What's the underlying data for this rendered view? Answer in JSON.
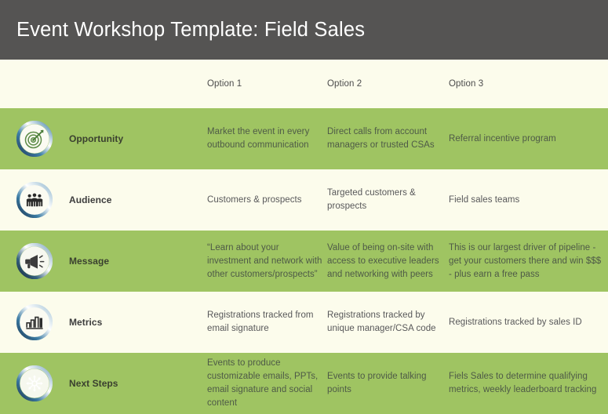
{
  "title": "Event Workshop Template: Field Sales",
  "colors": {
    "title_bar": "#555453",
    "band_green": "#9FC462",
    "band_cream": "#FCFCEC",
    "title_text": "#FFFFFF",
    "body_text": "#58585A"
  },
  "columns": {
    "icon_header": "",
    "label_header": "",
    "option_headers": [
      "Option 1",
      "Option 2",
      "Option 3"
    ]
  },
  "rows": [
    {
      "icon": "target-icon",
      "label": "Opportunity",
      "band": "green",
      "option1": "Market the event in every outbound communication",
      "option2": "Direct calls from account managers or trusted CSAs",
      "option3": "Referral incentive program"
    },
    {
      "icon": "people-group-icon",
      "label": "Audience",
      "band": "cream",
      "option1": "Customers & prospects",
      "option2": "Targeted customers & prospects",
      "option3": "Field sales teams"
    },
    {
      "icon": "megaphone-icon",
      "label": "Message",
      "band": "green",
      "option1": "“Learn about your investment and network with other customers/prospects”",
      "option2": "Value of being on-site with access to executive leaders and networking with peers",
      "option3": "This is our largest driver of pipeline - get your customers there and win $$$ - plus earn a free pass"
    },
    {
      "icon": "bar-chart-icon",
      "label": "Metrics",
      "band": "cream",
      "option1": "Registrations tracked from email signature",
      "option2": "Registrations tracked by unique manager/CSA code",
      "option3": "Registrations tracked by sales ID"
    },
    {
      "icon": "starburst-icon",
      "label": "Next Steps",
      "band": "green",
      "option1": "Events to produce customizable emails, PPTs, email signature and social content",
      "option2": "Events to provide talking points",
      "option3": "Fiels Sales to determine qualifying metrics, weekly leaderboard tracking"
    }
  ]
}
